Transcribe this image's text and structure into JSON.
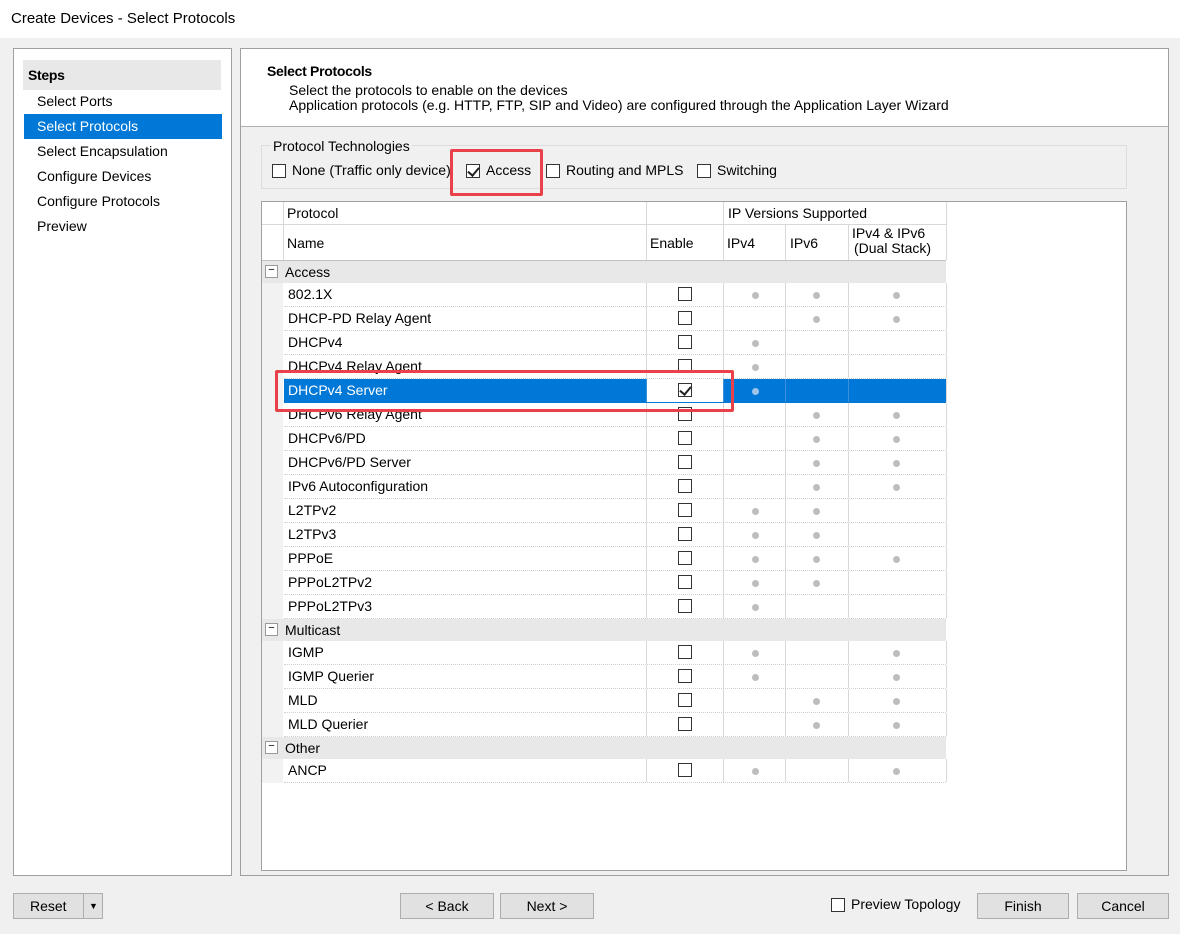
{
  "window": {
    "title": "Create Devices - Select Protocols"
  },
  "steps": {
    "heading": "Steps",
    "items": [
      {
        "label": "Select Ports",
        "active": false
      },
      {
        "label": "Select Protocols",
        "active": true
      },
      {
        "label": "Select Encapsulation",
        "active": false
      },
      {
        "label": "Configure Devices",
        "active": false
      },
      {
        "label": "Configure Protocols",
        "active": false
      },
      {
        "label": "Preview",
        "active": false
      }
    ]
  },
  "header": {
    "title": "Select Protocols",
    "line1": "Select the protocols to enable on the devices",
    "line2": "Application protocols (e.g. HTTP, FTP, SIP and Video) are configured through the Application Layer Wizard"
  },
  "technologies": {
    "label": "Protocol Technologies",
    "options": [
      {
        "label": "None (Traffic only device)",
        "checked": false
      },
      {
        "label": "Access",
        "checked": true
      },
      {
        "label": "Routing and MPLS",
        "checked": false
      },
      {
        "label": "Switching",
        "checked": false
      }
    ]
  },
  "grid": {
    "col_protocol": "Protocol",
    "col_ipversions": "IP Versions Supported",
    "col_name": "Name",
    "col_enable": "Enable",
    "col_ipv4": "IPv4",
    "col_ipv6": "IPv6",
    "col_dual_line1": "IPv4 & IPv6",
    "col_dual_line2": "(Dual Stack)",
    "groups": [
      {
        "name": "Access",
        "rows": [
          {
            "name": "802.1X",
            "enabled": false,
            "ipv4": true,
            "ipv6": true,
            "dual": true
          },
          {
            "name": "DHCP-PD Relay Agent",
            "enabled": false,
            "ipv4": false,
            "ipv6": true,
            "dual": true
          },
          {
            "name": "DHCPv4",
            "enabled": false,
            "ipv4": true,
            "ipv6": false,
            "dual": false
          },
          {
            "name": "DHCPv4 Relay Agent",
            "enabled": false,
            "ipv4": true,
            "ipv6": false,
            "dual": false
          },
          {
            "name": "DHCPv4 Server",
            "enabled": true,
            "ipv4": true,
            "ipv6": false,
            "dual": false,
            "selected": true
          },
          {
            "name": "DHCPv6 Relay Agent",
            "enabled": false,
            "ipv4": false,
            "ipv6": true,
            "dual": true
          },
          {
            "name": "DHCPv6/PD",
            "enabled": false,
            "ipv4": false,
            "ipv6": true,
            "dual": true
          },
          {
            "name": "DHCPv6/PD Server",
            "enabled": false,
            "ipv4": false,
            "ipv6": true,
            "dual": true
          },
          {
            "name": "IPv6 Autoconfiguration",
            "enabled": false,
            "ipv4": false,
            "ipv6": true,
            "dual": true
          },
          {
            "name": "L2TPv2",
            "enabled": false,
            "ipv4": true,
            "ipv6": true,
            "dual": false
          },
          {
            "name": "L2TPv3",
            "enabled": false,
            "ipv4": true,
            "ipv6": true,
            "dual": false
          },
          {
            "name": "PPPoE",
            "enabled": false,
            "ipv4": true,
            "ipv6": true,
            "dual": true
          },
          {
            "name": "PPPoL2TPv2",
            "enabled": false,
            "ipv4": true,
            "ipv6": true,
            "dual": false
          },
          {
            "name": "PPPoL2TPv3",
            "enabled": false,
            "ipv4": true,
            "ipv6": false,
            "dual": false
          }
        ]
      },
      {
        "name": "Multicast",
        "rows": [
          {
            "name": "IGMP",
            "enabled": false,
            "ipv4": true,
            "ipv6": false,
            "dual": true
          },
          {
            "name": "IGMP Querier",
            "enabled": false,
            "ipv4": true,
            "ipv6": false,
            "dual": true
          },
          {
            "name": "MLD",
            "enabled": false,
            "ipv4": false,
            "ipv6": true,
            "dual": true
          },
          {
            "name": "MLD Querier",
            "enabled": false,
            "ipv4": false,
            "ipv6": true,
            "dual": true
          }
        ]
      },
      {
        "name": "Other",
        "rows": [
          {
            "name": "ANCP",
            "enabled": false,
            "ipv4": true,
            "ipv6": false,
            "dual": true
          }
        ]
      }
    ]
  },
  "footer": {
    "reset_label": "Reset",
    "back_label": "< Back",
    "next_label": "Next >",
    "preview_topology_label": "Preview Topology",
    "preview_topology_checked": false,
    "finish_label": "Finish",
    "cancel_label": "Cancel"
  },
  "colors": {
    "selection": "#0078d7",
    "highlight_box": "#e8414a"
  }
}
